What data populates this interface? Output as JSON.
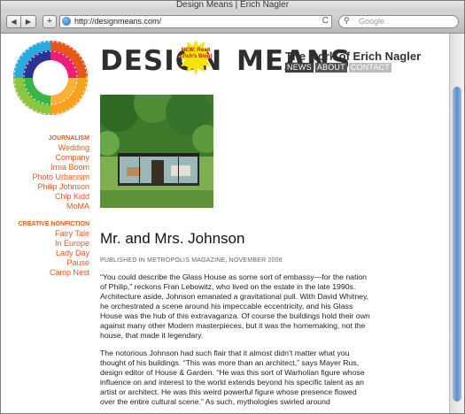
{
  "window": {
    "title": "Design Means | Erich Nagler"
  },
  "toolbar": {
    "back_label": "◀",
    "forward_label": "▶",
    "add_label": "+",
    "url": "http://designmeans.com/",
    "reload_label": "C",
    "search_placeholder": "Google"
  },
  "badge": {
    "words": [
      "MAGAZINES",
      "GRAPHICS",
      "BOOKS",
      "WRITING",
      "OBJECTS",
      "TYPOGRAPHY",
      "SPACES",
      "ILLUSTRATION"
    ]
  },
  "header": {
    "brand_left": "DESIGN",
    "brand_right": "MEANS",
    "burst_text": "NEW: Read Erich's Blog!",
    "tagline": "The work of Erich Nagler",
    "nav": [
      "NEWS",
      "ABOUT",
      "CONTACT"
    ]
  },
  "sidebar": {
    "section1_title": "JOURNALISM",
    "section1_items": [
      "Wedding",
      "Company",
      "Irma Boom",
      "Photo Urbanism",
      "Philip Johnson",
      "Chip Kidd",
      "MoMA"
    ],
    "section2_title": "CREATIVE NONFICTION",
    "section2_items": [
      "Fairy Tale",
      "In Europe",
      "Lady Day",
      "Pause",
      "Camp Nest"
    ]
  },
  "article": {
    "headline": "Mr. and Mrs. Johnson",
    "published": "PUBLISHED IN METROPOLIS MAGAZINE, NOVEMBER 2006",
    "paragraphs": [
      "“You could describe the Glass House as some sort of embassy—for the nation of Philip,” reckons Fran Lebowitz, who lived on the estate in the late 1990s. Architecture aside, Johnson emanated a gravitational pull. With David Whitney, he orchestrated a scene around his impeccable eccentricity, and his Glass House was the hub of this extravaganza. Of course the buildings hold their own against many other Modern masterpieces, but it was the homemaking, not the house, that made it legendary.",
      "The notorious Johnson had such flair that it almost didn’t matter what you thought of his buildings. “This was more than an architect,” says Mayer Rus, design editor of House & Garden. “He was this sort of Warholian figure whose influence on and interest to the world extends beyond his specific talent as an artist or architect. He was this weird powerful figure whose presence flowed over the entire cultural scene.” As such, mythologies swirled around"
    ]
  },
  "colors": {
    "accent_orange": "#e8571a",
    "burst_yellow": "#f5e400",
    "nav_dark": "#3d3d3d"
  }
}
